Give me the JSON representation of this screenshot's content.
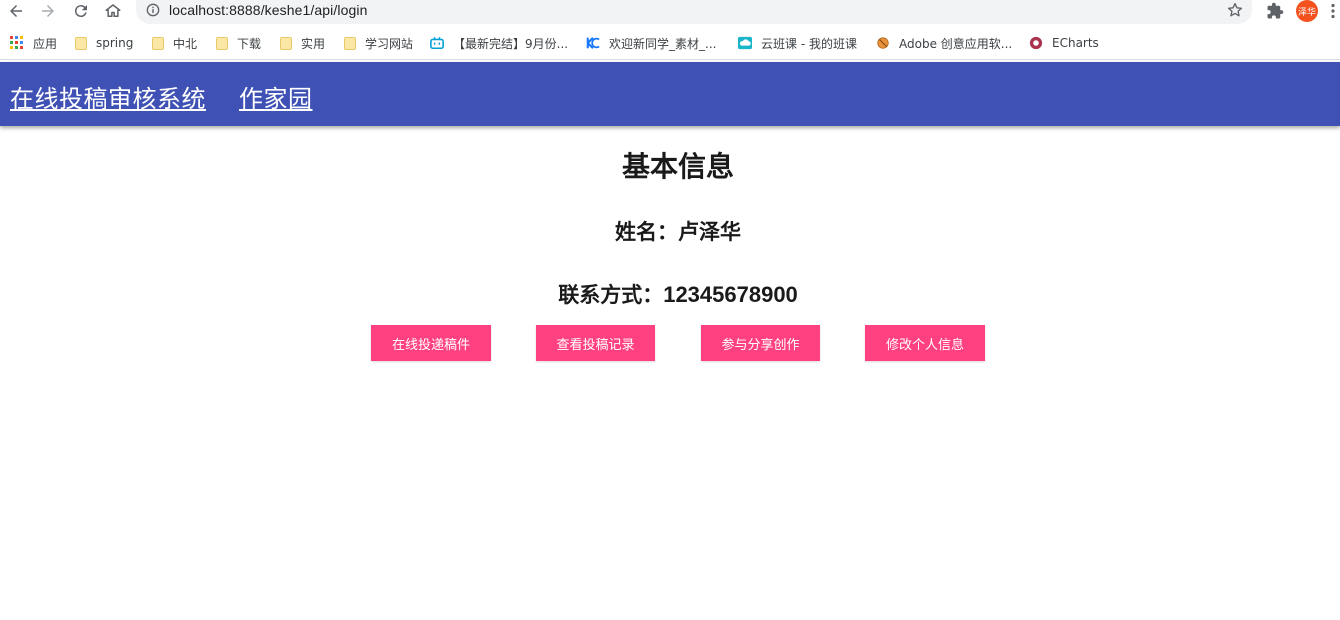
{
  "browser": {
    "url": "localhost:8888/keshe1/api/login",
    "profile_initials": "泽华",
    "bookmarks": [
      {
        "label": "应用",
        "icon": "apps-grid-icon"
      },
      {
        "label": "spring",
        "icon": "folder-icon"
      },
      {
        "label": "中北",
        "icon": "folder-icon"
      },
      {
        "label": "下载",
        "icon": "folder-icon"
      },
      {
        "label": "实用",
        "icon": "folder-icon"
      },
      {
        "label": "学习网站",
        "icon": "folder-icon"
      },
      {
        "label": "【最新完结】9月份...",
        "icon": "bilibili-icon"
      },
      {
        "label": "欢迎新同学_素材_...",
        "icon": "kc-logo-icon"
      },
      {
        "label": "云班课 - 我的班课",
        "icon": "cloud-class-icon"
      },
      {
        "label": "Adobe 创意应用软...",
        "icon": "adobe-icon"
      },
      {
        "label": "ECharts",
        "icon": "echarts-icon"
      }
    ]
  },
  "header": {
    "system_title": "在线投稿审核系统",
    "writer_link": "作家园"
  },
  "main": {
    "title": "基本信息",
    "name_label": "姓名：",
    "name_value": "卢泽华",
    "contact_label": "联系方式：",
    "contact_value": "12345678900",
    "buttons": [
      {
        "label": "在线投递稿件"
      },
      {
        "label": "查看投稿记录"
      },
      {
        "label": "参与分享创作"
      },
      {
        "label": "修改个人信息"
      }
    ]
  },
  "colors": {
    "header_bg": "#3f51b5",
    "button_bg": "#ff4081"
  }
}
